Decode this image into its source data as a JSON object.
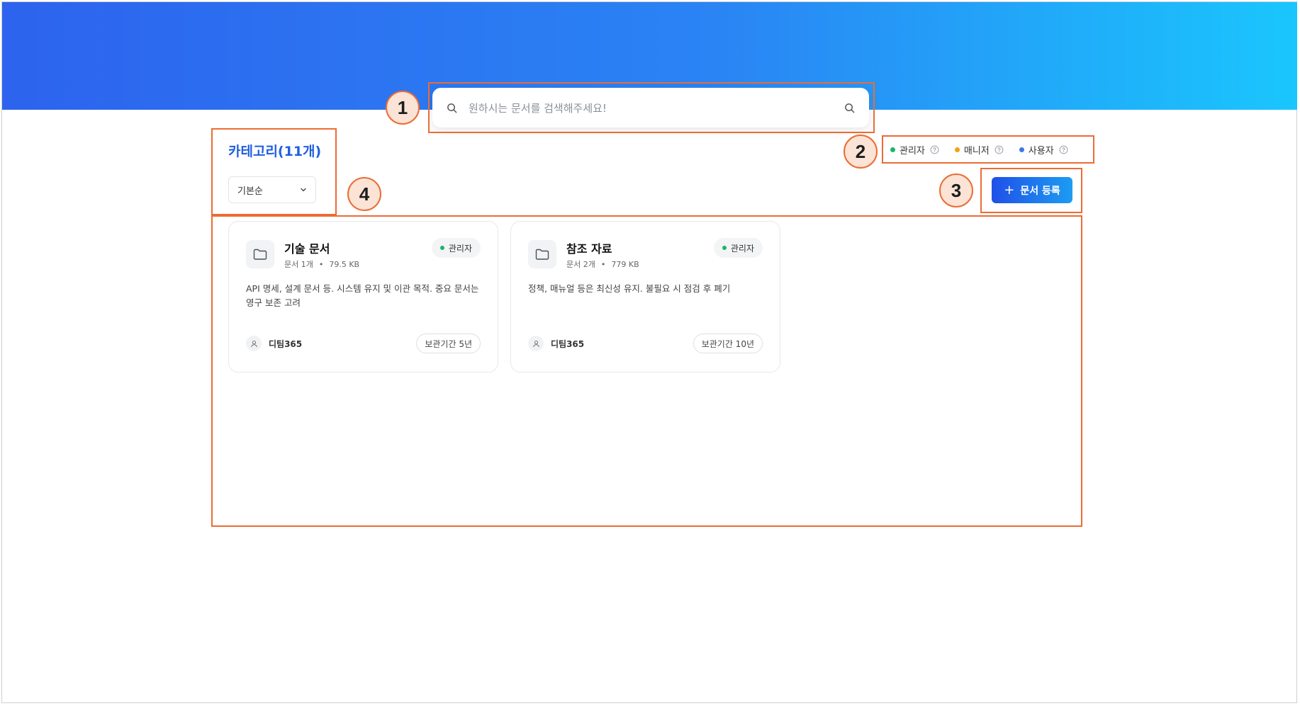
{
  "search": {
    "placeholder": "원하시는 문서를 검색해주세요!"
  },
  "category": {
    "title": "카테고리(11개)",
    "sort_value": "기본순"
  },
  "legend": [
    {
      "label": "관리자",
      "color": "#19b56b"
    },
    {
      "label": "매니저",
      "color": "#f2a20d"
    },
    {
      "label": "사용자",
      "color": "#3b78e7"
    }
  ],
  "actions": {
    "register_label": "문서 등록"
  },
  "cards": [
    {
      "name": "기술 문서",
      "count": "문서 1개",
      "size": "79.5 KB",
      "role": "관리자",
      "role_color": "#19b56b",
      "description": "API 명세, 설계 문서 등. 시스템 유지 및 이관 목적. 중요 문서는 영구 보존 고려",
      "owner": "디팀365",
      "retention": "보관기간 5년"
    },
    {
      "name": "참조 자료",
      "count": "문서 2개",
      "size": "779 KB",
      "role": "관리자",
      "role_color": "#19b56b",
      "description": "정책, 매뉴얼 등은 최신성 유지. 불필요 시 점검 후 폐기",
      "owner": "디팀365",
      "retention": "보관기간 10년"
    }
  ],
  "annotations": [
    "1",
    "2",
    "3",
    "4"
  ]
}
